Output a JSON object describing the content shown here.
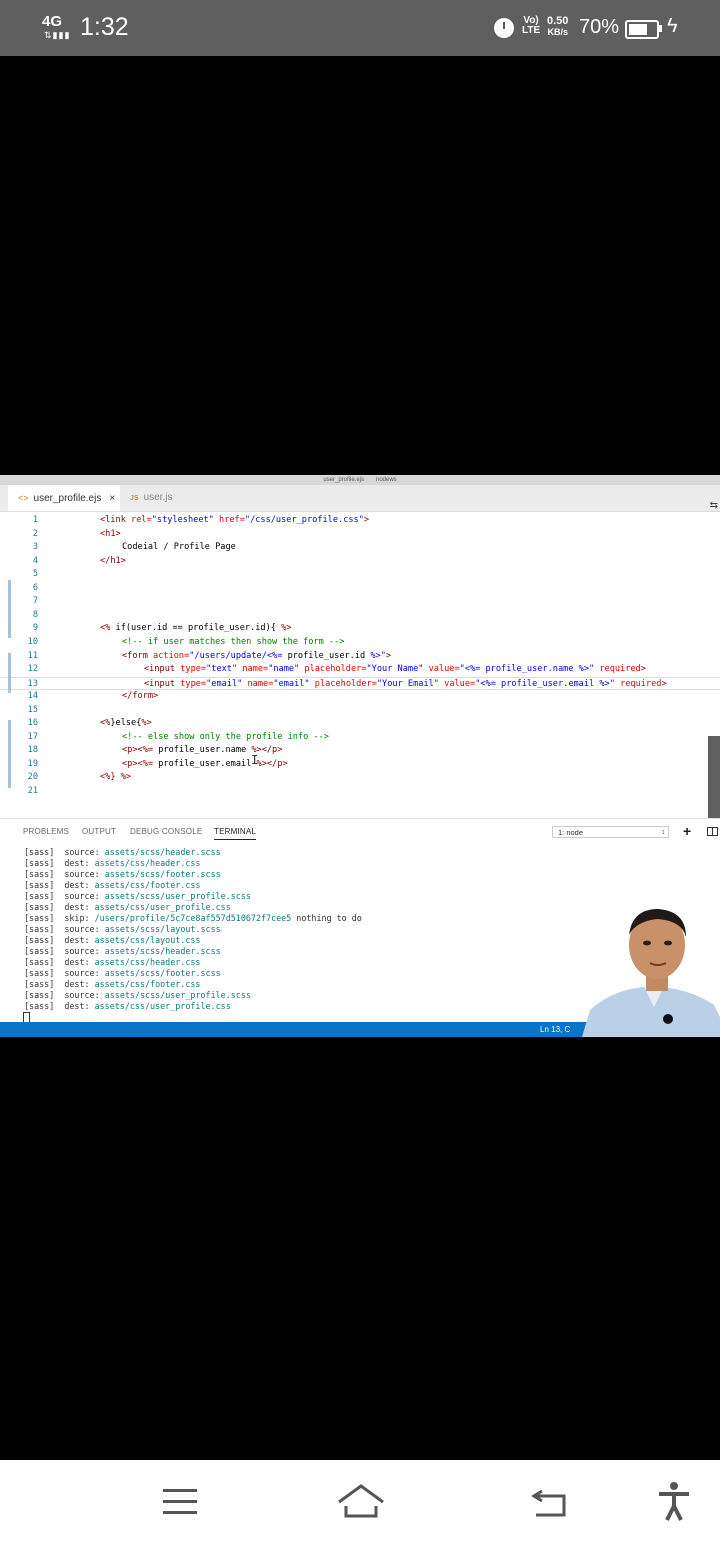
{
  "status_bar": {
    "network": "4G",
    "time": "1:32",
    "volte_top": "Vo)",
    "volte_bottom": "LTE",
    "speed_top": "0.50",
    "speed_bottom": "KB/s",
    "battery_percent": "70%",
    "battery_level": 0.7
  },
  "window": {
    "title_left": "user_profile.ejs",
    "title_right": "nodews"
  },
  "tabs": [
    {
      "icon": "<>",
      "label": "user_profile.ejs",
      "close": "×"
    },
    {
      "icon": "JS",
      "label": "user.js"
    }
  ],
  "editor": {
    "lines": [
      {
        "n": "1",
        "segs": [
          [
            "t",
            "<link "
          ],
          [
            "a",
            "rel="
          ],
          [
            "s",
            "\"stylesheet\" "
          ],
          [
            "a",
            "href="
          ],
          [
            "s",
            "\"/css/user_profile.css\""
          ],
          [
            "t",
            ">"
          ]
        ],
        "indent": 42
      },
      {
        "n": "2",
        "segs": [
          [
            "t",
            "<h1>"
          ]
        ],
        "indent": 42
      },
      {
        "n": "3",
        "segs": [
          [
            "x",
            "Codeial / Profile Page"
          ]
        ],
        "indent": 64
      },
      {
        "n": "4",
        "segs": [
          [
            "t",
            "</h1>"
          ]
        ],
        "indent": 42
      },
      {
        "n": "5",
        "segs": [],
        "indent": 42
      },
      {
        "n": "6",
        "segs": [],
        "indent": 42
      },
      {
        "n": "7",
        "segs": [],
        "indent": 42
      },
      {
        "n": "8",
        "segs": [],
        "indent": 42
      },
      {
        "n": "9",
        "segs": [
          [
            "t",
            "<% "
          ],
          [
            "x",
            "if(user.id == profile_user.id){ "
          ],
          [
            "t",
            "%>"
          ]
        ],
        "indent": 42
      },
      {
        "n": "10",
        "segs": [
          [
            "c",
            "<!-- if user matches then show the form -->"
          ]
        ],
        "indent": 64
      },
      {
        "n": "11",
        "segs": [
          [
            "t",
            "<form "
          ],
          [
            "a",
            "action="
          ],
          [
            "s",
            "\"/users/update/<%= "
          ],
          [
            "x",
            "profile_user.id "
          ],
          [
            "s",
            "%>\""
          ],
          [
            "t",
            ">"
          ]
        ],
        "indent": 64
      },
      {
        "n": "12",
        "segs": [
          [
            "t",
            "<input "
          ],
          [
            "a",
            "type="
          ],
          [
            "s",
            "\"text\" "
          ],
          [
            "a",
            "name="
          ],
          [
            "s",
            "\"name\" "
          ],
          [
            "a",
            "placeholder="
          ],
          [
            "s",
            "\"Your Name\" "
          ],
          [
            "a",
            "value="
          ],
          [
            "s",
            "\"<%= profile_user.name %>\" "
          ],
          [
            "a",
            "required"
          ],
          [
            "t",
            ">"
          ]
        ],
        "indent": 86
      },
      {
        "n": "13",
        "segs": [
          [
            "t",
            "<input "
          ],
          [
            "a",
            "type="
          ],
          [
            "s",
            "\"email\" "
          ],
          [
            "a",
            "name="
          ],
          [
            "s",
            "\"email\" "
          ],
          [
            "a",
            "placeholder="
          ],
          [
            "s",
            "\"Your Email\" "
          ],
          [
            "a",
            "value="
          ],
          [
            "s",
            "\"<%= profile_user.email %>\" "
          ],
          [
            "a",
            "required"
          ],
          [
            "t",
            ">"
          ]
        ],
        "indent": 86
      },
      {
        "n": "14",
        "segs": [
          [
            "t",
            "</form>"
          ]
        ],
        "indent": 64
      },
      {
        "n": "15",
        "segs": [],
        "indent": 42
      },
      {
        "n": "16",
        "segs": [
          [
            "t",
            "<%"
          ],
          [
            "x",
            "}else{"
          ],
          [
            "t",
            "%>"
          ]
        ],
        "indent": 42
      },
      {
        "n": "17",
        "segs": [
          [
            "c",
            "<!-- else show only the profile info -->"
          ]
        ],
        "indent": 64
      },
      {
        "n": "18",
        "segs": [
          [
            "t",
            "<p><%= "
          ],
          [
            "x",
            "profile_user.name "
          ],
          [
            "t",
            "%></p>"
          ]
        ],
        "indent": 64
      },
      {
        "n": "19",
        "segs": [
          [
            "t",
            "<p><%= "
          ],
          [
            "x",
            "profile_user.email "
          ],
          [
            "t",
            "%></p>"
          ]
        ],
        "indent": 64
      },
      {
        "n": "20",
        "segs": [
          [
            "t",
            "<%} %>"
          ]
        ],
        "indent": 42
      },
      {
        "n": "21",
        "segs": [],
        "indent": 42
      }
    ],
    "current_line": "13"
  },
  "panel": {
    "tabs": [
      "PROBLEMS",
      "OUTPUT",
      "DEBUG CONSOLE",
      "TERMINAL"
    ],
    "active_tab": "TERMINAL",
    "terminal_select": "1: node",
    "terminal_lines": [
      {
        "prefix": "[sass]  source: ",
        "path": "assets/scss/header.scss",
        "rest": ""
      },
      {
        "prefix": "[sass]  dest: ",
        "path": "assets/css/header.css",
        "rest": ""
      },
      {
        "prefix": "[sass]  source: ",
        "path": "assets/scss/footer.scss",
        "rest": ""
      },
      {
        "prefix": "[sass]  dest: ",
        "path": "assets/css/footer.css",
        "rest": ""
      },
      {
        "prefix": "[sass]  source: ",
        "path": "assets/scss/user_profile.scss",
        "rest": ""
      },
      {
        "prefix": "[sass]  dest: ",
        "path": "assets/css/user_profile.css",
        "rest": ""
      },
      {
        "prefix": "[sass]  skip: ",
        "path": "/users/profile/5c7ce8af557d510672f7cee5",
        "rest": " nothing to do"
      },
      {
        "prefix": "[sass]  source: ",
        "path": "assets/scss/layout.scss",
        "rest": ""
      },
      {
        "prefix": "[sass]  dest: ",
        "path": "assets/css/layout.css",
        "rest": ""
      },
      {
        "prefix": "[sass]  source: ",
        "path": "assets/scss/header.scss",
        "rest": ""
      },
      {
        "prefix": "[sass]  dest: ",
        "path": "assets/css/header.css",
        "rest": ""
      },
      {
        "prefix": "[sass]  source: ",
        "path": "assets/scss/footer.scss",
        "rest": ""
      },
      {
        "prefix": "[sass]  dest: ",
        "path": "assets/css/footer.css",
        "rest": ""
      },
      {
        "prefix": "[sass]  source: ",
        "path": "assets/scss/user_profile.scss",
        "rest": ""
      },
      {
        "prefix": "[sass]  dest: ",
        "path": "assets/css/user_profile.css",
        "rest": ""
      }
    ]
  },
  "status_line": {
    "position": "Ln 13, C"
  },
  "nav": {
    "menu_icon": "menu-icon",
    "home_icon": "home-icon",
    "back_icon": "back-icon",
    "accessibility_icon": "accessibility-icon"
  },
  "colors": {
    "status_bar_bg": "#5f5f5f",
    "vscode_status_blue": "#0a74c9",
    "terminal_path": "#0e7a7a"
  }
}
